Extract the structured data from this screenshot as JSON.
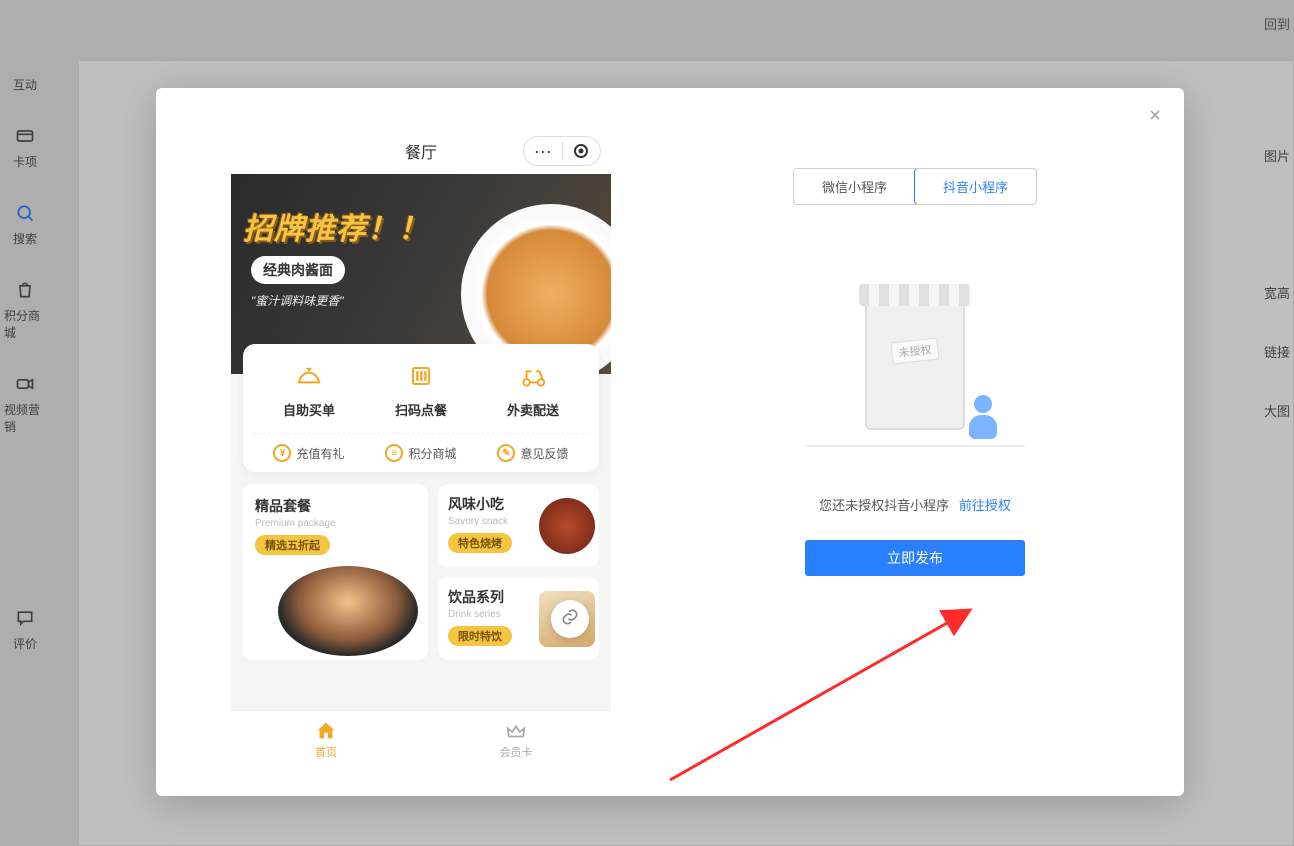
{
  "bg": {
    "top_right": "回到",
    "sidebar": [
      {
        "label": "互动"
      },
      {
        "label": "卡项"
      },
      {
        "label": "搜索"
      },
      {
        "label": "积分商城"
      },
      {
        "label": "视频营销"
      },
      {
        "label": "评价"
      }
    ],
    "right_labels": [
      "图片",
      "宽高",
      "链接",
      "大图"
    ]
  },
  "modal": {
    "phone": {
      "title": "餐厅",
      "hero_title": "招牌推荐！！",
      "hero_badge": "经典肉酱面",
      "hero_sub": "\"蜜汁调料味更香\"",
      "actions": [
        {
          "label": "自助买单"
        },
        {
          "label": "扫码点餐"
        },
        {
          "label": "外卖配送"
        }
      ],
      "sub_actions": [
        {
          "label": "充值有礼"
        },
        {
          "label": "积分商城"
        },
        {
          "label": "意见反馈"
        }
      ],
      "tile_left": {
        "title": "精品套餐",
        "sub": "Premium package",
        "tag": "精选五折起"
      },
      "tile_r1": {
        "title": "风味小吃",
        "sub": "Savory snack",
        "tag": "特色烧烤"
      },
      "tile_r2": {
        "title": "饮品系列",
        "sub": "Drink series",
        "tag": "限时特饮"
      },
      "nav": [
        {
          "label": "首页"
        },
        {
          "label": "会员卡"
        }
      ]
    },
    "right": {
      "tabs": [
        {
          "label": "微信小程序"
        },
        {
          "label": "抖音小程序"
        }
      ],
      "illus_label": "未授权",
      "message": "您还未授权抖音小程序",
      "auth_link": "前往授权",
      "publish_btn": "立即发布"
    }
  }
}
